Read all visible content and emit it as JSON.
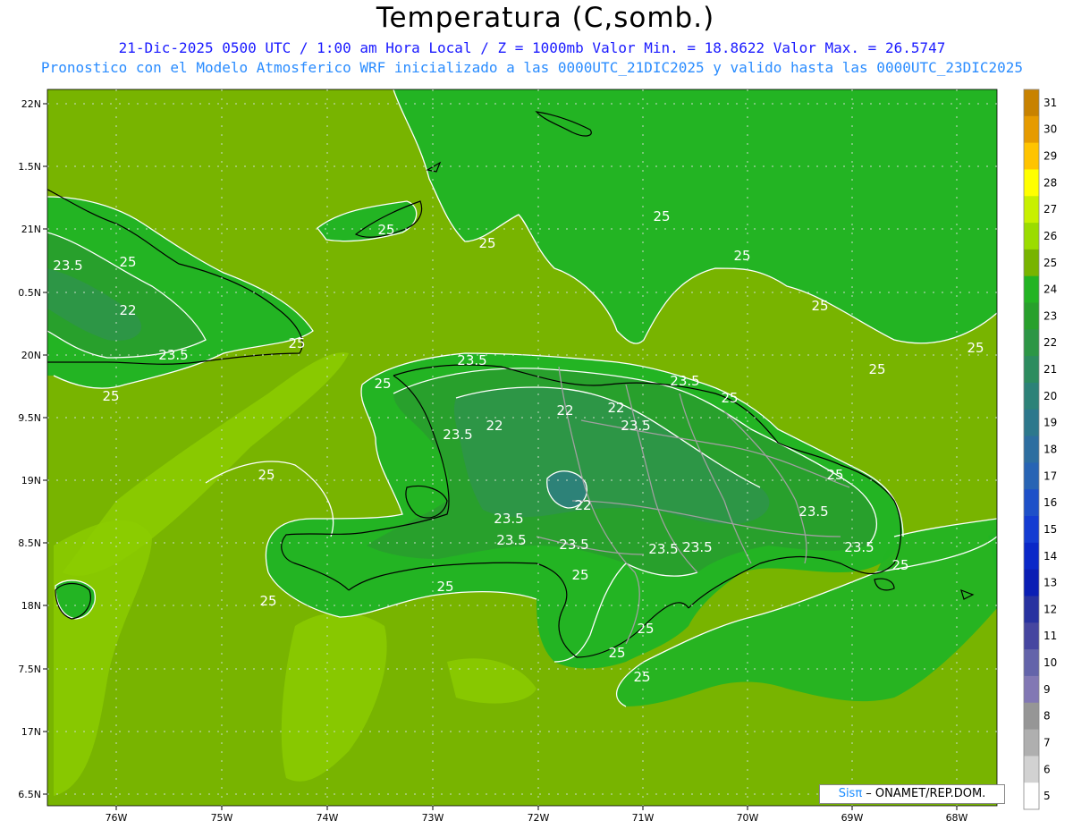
{
  "header": {
    "title": "Temperatura (C,somb.)",
    "line1": "21-Dic-2025  0500 UTC / 1:00 am Hora Local / Z = 1000mb   Valor Min. = 18.8622  Valor Max. = 26.5747",
    "line2": "Pronostico con el Modelo Atmosferico WRF inicializado a las 0000UTC_21DIC2025 y valido hasta las  0000UTC_23DIC2025"
  },
  "axes": {
    "lat_labels": [
      "22N",
      "1.5N",
      "21N",
      "0.5N",
      "20N",
      "9.5N",
      "19N",
      "8.5N",
      "18N",
      "7.5N",
      "17N",
      "6.5N"
    ],
    "lon_labels": [
      "76W",
      "75W",
      "74W",
      "73W",
      "72W",
      "71W",
      "70W",
      "69W",
      "68W"
    ]
  },
  "colorbar": {
    "labels": [
      "31",
      "30",
      "29",
      "28",
      "27",
      "26",
      "25",
      "24",
      "23",
      "22",
      "21",
      "20",
      "19",
      "18",
      "17",
      "16",
      "15",
      "14",
      "13",
      "12",
      "11",
      "10",
      "9",
      "8",
      "7",
      "6",
      "5"
    ],
    "colors": [
      "#c88200",
      "#e69b00",
      "#ffc400",
      "#ffff00",
      "#c8f000",
      "#9bdc00",
      "#78b400",
      "#23b423",
      "#28a02c",
      "#2d9646",
      "#2d8c5f",
      "#2d8278",
      "#2d788c",
      "#2d6ea0",
      "#2864b4",
      "#1e50c8",
      "#143cd2",
      "#0a28c8",
      "#0a1eb4",
      "#2832a0",
      "#4646a0",
      "#6464aa",
      "#8278b4",
      "#969696",
      "#afafaf",
      "#d2d2d2",
      "#ffffff"
    ]
  },
  "contour_labels": [
    "25",
    "25",
    "25",
    "25",
    "23.5",
    "25",
    "22",
    "23.5",
    "25",
    "25",
    "25",
    "25",
    "23.5",
    "25",
    "22",
    "22",
    "23.5",
    "23.5",
    "22",
    "23.5",
    "25",
    "25",
    "22",
    "23.5",
    "23.5",
    "23.5",
    "23.5",
    "23.5",
    "23.5",
    "25",
    "25",
    "25",
    "25",
    "23.5",
    "25",
    "25",
    "25",
    "25",
    "25"
  ],
  "credit": {
    "sis": "Sisπ",
    "rest": " – ONAMET/REP.DOM."
  }
}
